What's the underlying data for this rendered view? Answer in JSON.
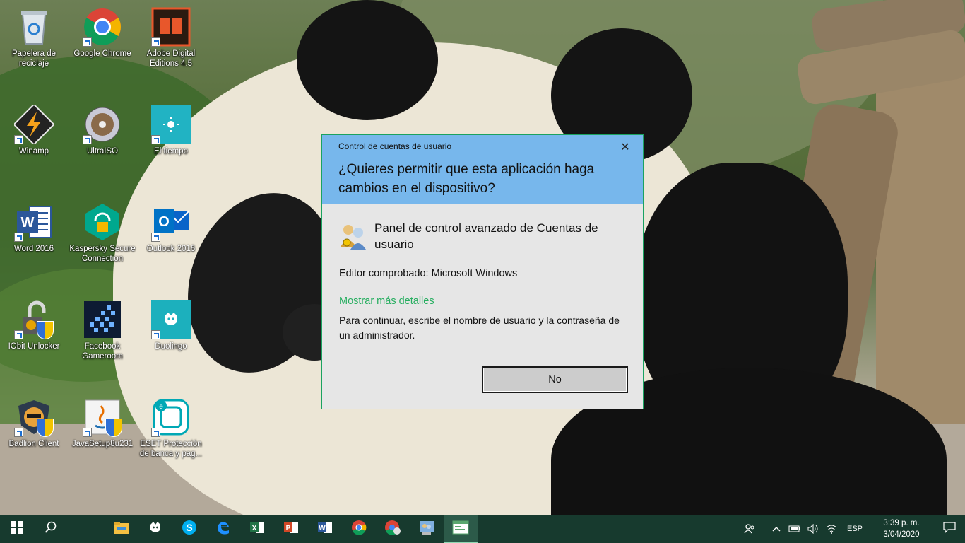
{
  "desktop": {
    "icons": [
      {
        "label": "Papelera de reciclaje",
        "icon": "recycle-bin-icon"
      },
      {
        "label": "Google Chrome",
        "icon": "chrome-icon"
      },
      {
        "label": "Adobe Digital Editions 4.5",
        "icon": "adobe-digital-editions-icon"
      },
      {
        "label": "Winamp",
        "icon": "winamp-icon"
      },
      {
        "label": "UltraISO",
        "icon": "ultraiso-icon"
      },
      {
        "label": "El tiempo",
        "icon": "weather-icon"
      },
      {
        "label": "Word 2016",
        "icon": "word-icon"
      },
      {
        "label": "Kaspersky Secure Connection",
        "icon": "kaspersky-icon"
      },
      {
        "label": "Outlook 2016",
        "icon": "outlook-icon"
      },
      {
        "label": "IObit Unlocker",
        "icon": "iobit-unlocker-icon"
      },
      {
        "label": "Facebook Gameroom",
        "icon": "facebook-gameroom-icon"
      },
      {
        "label": "Duolingo",
        "icon": "duolingo-icon"
      },
      {
        "label": "Badlion Client",
        "icon": "badlion-icon"
      },
      {
        "label": "JavaSetup8u231",
        "icon": "java-setup-icon"
      },
      {
        "label": "ESET Protección de banca y pag...",
        "icon": "eset-icon"
      }
    ]
  },
  "uac": {
    "title": "Control de cuentas de usuario",
    "question": "¿Quieres permitir que esta aplicación haga cambios en el dispositivo?",
    "app_name": "Panel de control avanzado de Cuentas de usuario",
    "publisher": "Editor comprobado: Microsoft Windows",
    "details_link": "Mostrar más detalles",
    "prompt": "Para continuar, escribe el nombre de usuario y la contraseña de un administrador.",
    "no_button": "No",
    "close_glyph": "✕"
  },
  "taskbar": {
    "language": "ESP",
    "time": "3:39 p. m.",
    "date": "3/04/2020",
    "apps": [
      "start-icon",
      "search-icon",
      "file-explorer-icon",
      "duolingo-icon",
      "skype-icon",
      "edge-icon",
      "excel-icon",
      "powerpoint-icon",
      "word-icon",
      "chrome-icon",
      "chrome-profile-icon",
      "user-accounts-icon",
      "uac-window-icon"
    ]
  },
  "colors": {
    "uac_header": "#77b7ec",
    "uac_border": "#1aa260",
    "link": "#27ae60",
    "taskbar": "#173a2e"
  }
}
